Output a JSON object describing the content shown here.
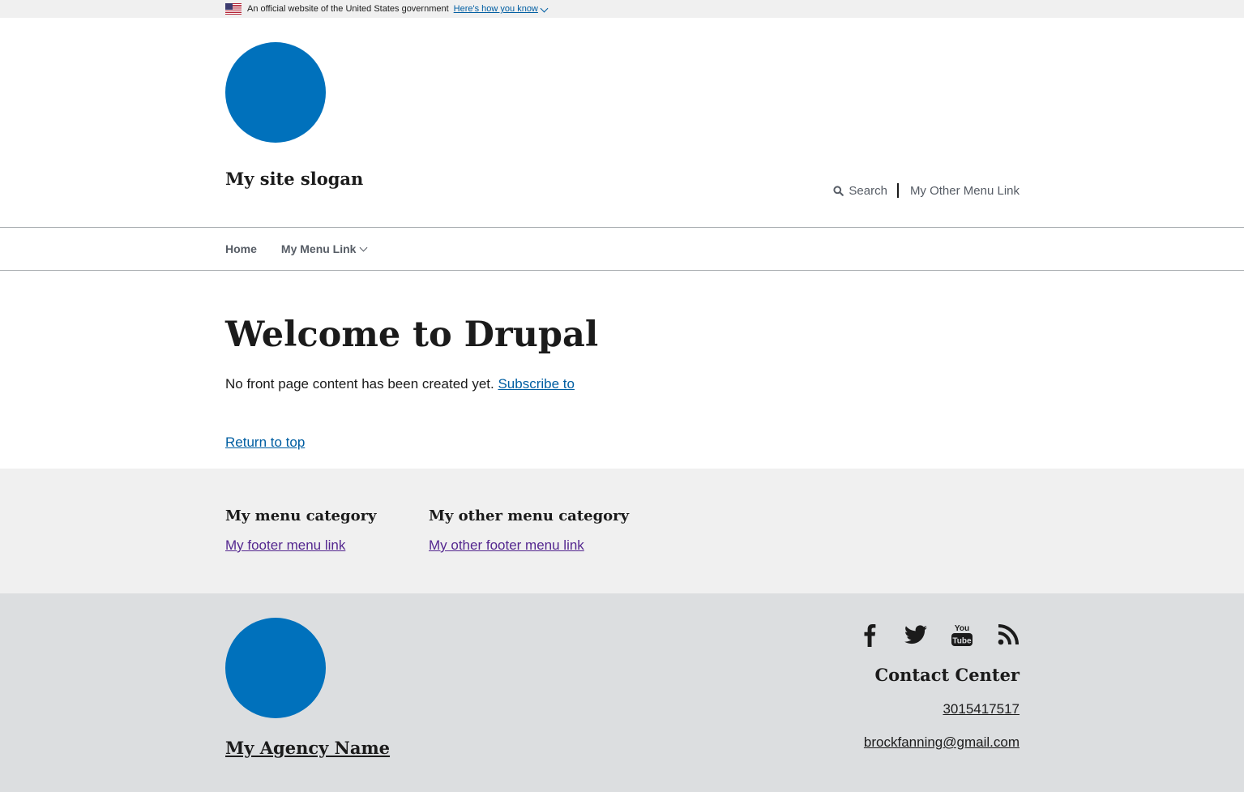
{
  "gov_banner": {
    "text": "An official website of the United States government",
    "link": "Here's how you know",
    "icon": "us-flag-icon"
  },
  "header": {
    "logo_icon": "site-logo-circle",
    "slogan": "My site slogan",
    "secondary_nav": {
      "search_label": "Search",
      "search_icon": "magnifier-icon",
      "other_link": "My Other Menu Link"
    }
  },
  "main_nav": {
    "items": [
      {
        "label": "Home"
      },
      {
        "label": "My Menu Link",
        "has_dropdown": true
      }
    ]
  },
  "main": {
    "title": "Welcome to Drupal",
    "body_text": "No front page content has been created yet.",
    "body_link": "Subscribe to",
    "return_to_top": "Return to top"
  },
  "footer_menu": {
    "columns": [
      {
        "heading": "My menu category",
        "link": "My footer menu link"
      },
      {
        "heading": "My other menu category",
        "link": "My other footer menu link"
      }
    ]
  },
  "footer_secondary": {
    "agency_logo_icon": "agency-logo-circle",
    "agency_name": "My Agency Name",
    "social_icons": [
      "facebook-icon",
      "twitter-icon",
      "youtube-icon",
      "rss-icon"
    ],
    "contact_heading": "Contact Center",
    "phone": "3015417517",
    "email": "brockfanning@gmail.com"
  },
  "colors": {
    "primary_blue": "#0071bc",
    "link_blue": "#005ea2",
    "visited_link": "#54278f",
    "footer_primary_bg": "#f0f0f0",
    "footer_secondary_bg": "#dcdee0"
  }
}
